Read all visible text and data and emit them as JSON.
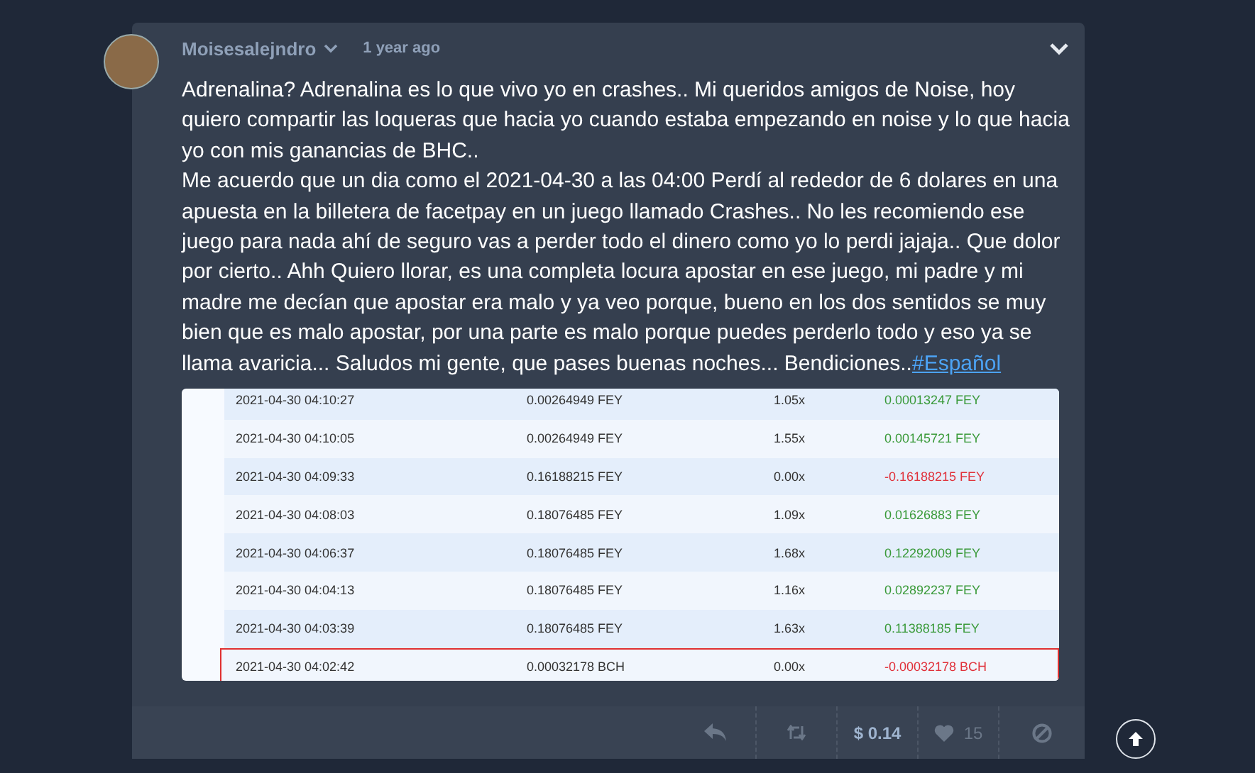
{
  "post": {
    "author": "Moisesalejndro",
    "time": "1 year ago",
    "paragraphs": [
      {
        "text": "Adrenalina? Adrenalina es lo que vivo yo en crashes.. Mi queridos amigos de Noise, hoy quiero compartir las loqueras que hacia yo cuando estaba empezando en noise y lo que hacia yo con mis ganancias de BHC.."
      },
      {
        "text": "Me acuerdo que un dia como el 2021-04-30 a las 04:00 Perdí al rededor de 6 dolares en una apuesta en la billetera de facetpay en un juego llamado Crashes.. No les recomiendo ese juego para nada ahí de seguro vas a perder todo el dinero como yo lo perdi jajaja.. Que dolor por cierto.. Ahh Quiero llorar, es una completa locura apostar en ese juego, mi padre y mi madre me decían que apostar era malo y ya veo porque, bueno en los dos sentidos se muy bien que es malo apostar, por una parte es malo porque puedes perderlo todo y eso ya se llama avaricia... Saludos mi gente, que pases buenas noches... Bendiciones..",
        "hashtag": "#Español"
      }
    ]
  },
  "bets": [
    {
      "time": "2021-04-30 04:10:27",
      "amount": "0.00264949 FEY",
      "multiplier": "1.05x",
      "profit": "0.00013247 FEY",
      "kind": "gain",
      "highlighted": false
    },
    {
      "time": "2021-04-30 04:10:05",
      "amount": "0.00264949 FEY",
      "multiplier": "1.55x",
      "profit": "0.00145721 FEY",
      "kind": "gain",
      "highlighted": false
    },
    {
      "time": "2021-04-30 04:09:33",
      "amount": "0.16188215 FEY",
      "multiplier": "0.00x",
      "profit": "-0.16188215 FEY",
      "kind": "loss",
      "highlighted": false
    },
    {
      "time": "2021-04-30 04:08:03",
      "amount": "0.18076485 FEY",
      "multiplier": "1.09x",
      "profit": "0.01626883 FEY",
      "kind": "gain",
      "highlighted": false
    },
    {
      "time": "2021-04-30 04:06:37",
      "amount": "0.18076485 FEY",
      "multiplier": "1.68x",
      "profit": "0.12292009 FEY",
      "kind": "gain",
      "highlighted": false
    },
    {
      "time": "2021-04-30 04:04:13",
      "amount": "0.18076485 FEY",
      "multiplier": "1.16x",
      "profit": "0.02892237 FEY",
      "kind": "gain",
      "highlighted": false
    },
    {
      "time": "2021-04-30 04:03:39",
      "amount": "0.18076485 FEY",
      "multiplier": "1.63x",
      "profit": "0.11388185 FEY",
      "kind": "gain",
      "highlighted": false
    },
    {
      "time": "2021-04-30 04:02:42",
      "amount": "0.00032178 BCH",
      "multiplier": "0.00x",
      "profit": "-0.00032178 BCH",
      "kind": "loss",
      "highlighted": true
    }
  ],
  "footer": {
    "tip": "$ 0.14",
    "likes": "15"
  }
}
